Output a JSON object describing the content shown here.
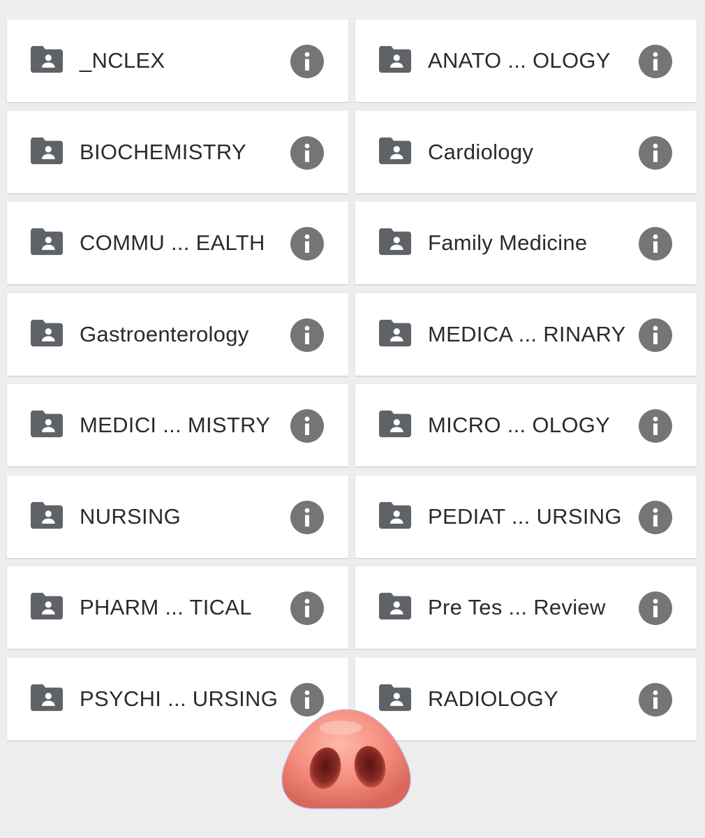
{
  "folders": [
    {
      "label": "_NCLEX"
    },
    {
      "label": "ANATO ... OLOGY"
    },
    {
      "label": "BIOCHEMISTRY"
    },
    {
      "label": "Cardiology"
    },
    {
      "label": "COMMU ... EALTH"
    },
    {
      "label": "Family Medicine"
    },
    {
      "label": "Gastroenterology"
    },
    {
      "label": "MEDICA ... RINARY"
    },
    {
      "label": "MEDICI ... MISTRY"
    },
    {
      "label": "MICRO ... OLOGY"
    },
    {
      "label": "NURSING"
    },
    {
      "label": "PEDIAT ... URSING"
    },
    {
      "label": "PHARM ... TICAL"
    },
    {
      "label": "Pre Tes ... Review"
    },
    {
      "label": "PSYCHI ... URSING"
    },
    {
      "label": "RADIOLOGY"
    }
  ],
  "icons": {
    "folder": "shared-folder-icon",
    "info": "info-icon",
    "sticker": "pig-nose-emoji"
  },
  "colors": {
    "background": "#ededed",
    "card": "#ffffff",
    "icon": "#5f6368",
    "info_circle": "#757575",
    "text": "#2b2b2b"
  }
}
